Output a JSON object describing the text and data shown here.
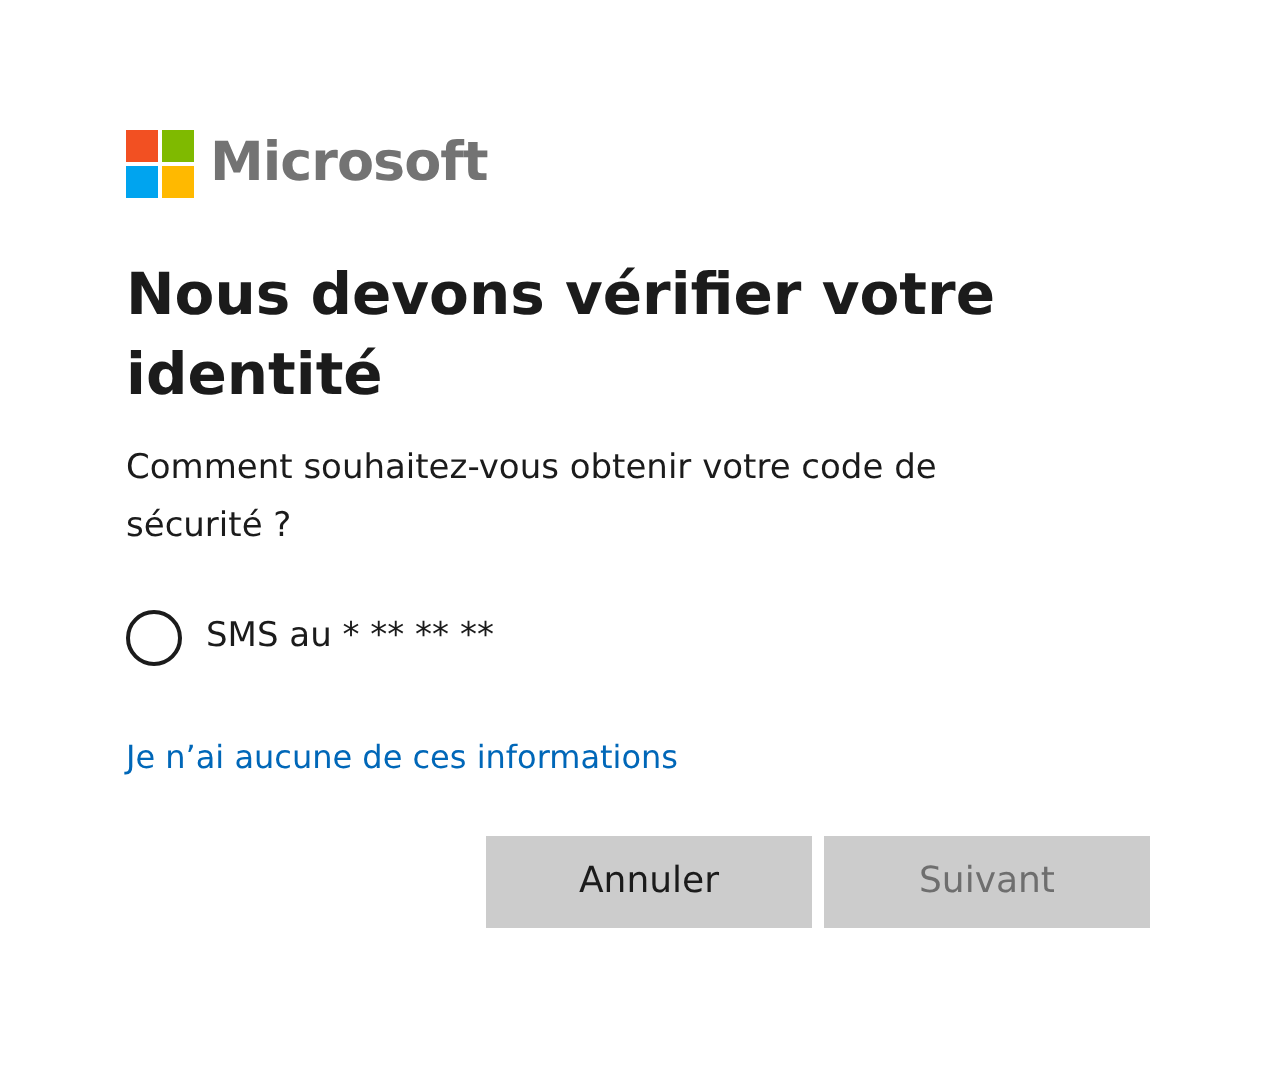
{
  "brand": {
    "name": "Microsoft"
  },
  "title": "Nous devons vérifier votre identité",
  "question": "Comment souhaitez-vous obtenir votre code de sécurité ?",
  "options": [
    {
      "label": "SMS au * ** ** **",
      "selected": false
    }
  ],
  "link": "Je n’ai aucune de ces informations",
  "buttons": [
    {
      "label": "Annuler",
      "disabled": false
    },
    {
      "label": "Suivant",
      "disabled": true
    }
  ]
}
